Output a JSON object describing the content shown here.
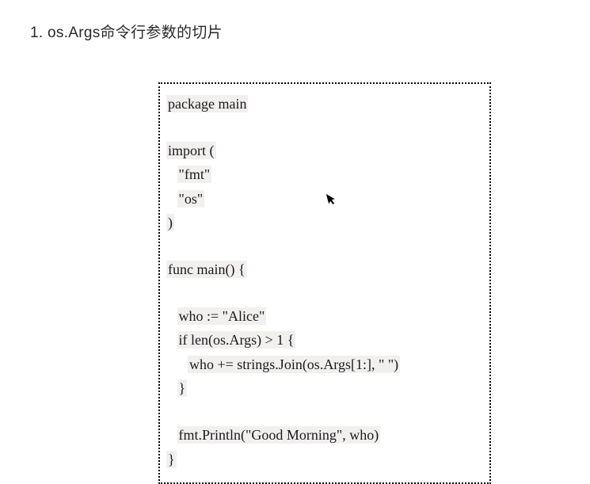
{
  "heading": "1. os.Args命令行参数的切片",
  "code": {
    "l1": "package main",
    "l2": "import (",
    "l3": "\"fmt\"",
    "l4": "\"os\"",
    "l5": ")",
    "l6": "func main() {",
    "l7": "who := \"Alice\"",
    "l8": "if len(os.Args) > 1 {",
    "l9": "who += strings.Join(os.Args[1:], \" \")",
    "l10": "}",
    "l11": "fmt.Println(\"Good Morning\", who)",
    "l12": "}"
  }
}
